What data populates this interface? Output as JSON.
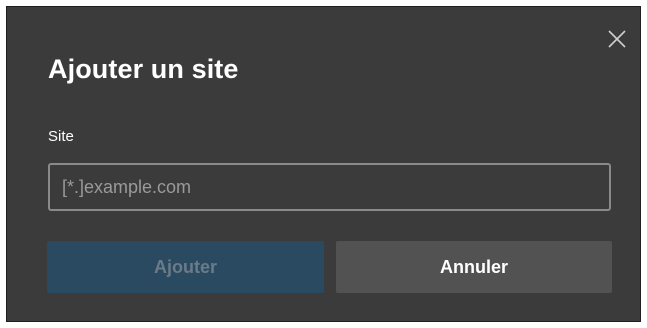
{
  "dialog": {
    "title": "Ajouter un site",
    "close_icon": "close-icon",
    "field": {
      "label": "Site",
      "value": "",
      "placeholder": "[*.]example.com"
    },
    "buttons": {
      "add_label": "Ajouter",
      "add_disabled": true,
      "cancel_label": "Annuler"
    }
  },
  "colors": {
    "dialog_background": "#3b3b3b",
    "primary_disabled": "#2a4a61",
    "secondary_button": "#525252",
    "input_border": "#8a8a8a",
    "text": "#ffffff"
  }
}
